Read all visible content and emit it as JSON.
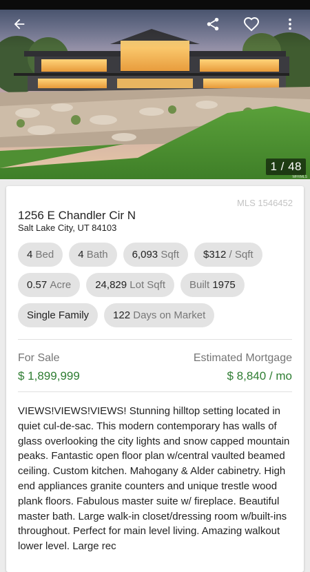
{
  "photo": {
    "counter": "1 / 48",
    "watermark": "WFRMLS"
  },
  "toolbar": {
    "back_icon": "arrow-back-icon",
    "share_icon": "share-icon",
    "favorite_icon": "heart-outline-icon",
    "more_icon": "more-vert-icon"
  },
  "listing": {
    "mls": "MLS 1546452",
    "address_line1": "1256 E Chandler Cir N",
    "address_line2": "Salt Lake City, UT 84103",
    "chips": [
      [
        {
          "value": "4",
          "label": "Bed"
        },
        {
          "value": "4",
          "label": "Bath"
        },
        {
          "value": "6,093",
          "label": "Sqft"
        },
        {
          "value": "$312",
          "label": "/ Sqft"
        }
      ],
      [
        {
          "value": "0.57",
          "label": "Acre"
        },
        {
          "value": "24,829",
          "label": "Lot Sqft"
        },
        {
          "value": "1975",
          "label": "Built",
          "label_first": true
        }
      ],
      [
        {
          "value": "Single Family",
          "label": ""
        },
        {
          "value": "122",
          "label": "Days on Market"
        }
      ]
    ],
    "sale_label": "For Sale",
    "sale_price": "$ 1,899,999",
    "mortgage_label": "Estimated Mortgage",
    "mortgage_price": "$ 8,840 / mo",
    "description": "VIEWS!VIEWS!VIEWS! Stunning hilltop setting located in quiet cul-de-sac. This modern contemporary has walls of glass overlooking the city lights and snow capped mountain peaks. Fantastic open floor plan w/central vaulted beamed ceiling. Custom kitchen. Mahogany & Alder cabinetry. High end appliances granite counters and unique trestle wood plank floors. Fabulous master suite w/ fireplace. Beautiful master bath. Large walk-in closet/dressing room w/built-ins throughout. Perfect for main level living. Amazing walkout lower level. Large rec"
  },
  "colors": {
    "price_green": "#2e7d32",
    "chip_bg": "#e3e3e3",
    "page_bg": "#ececec"
  }
}
